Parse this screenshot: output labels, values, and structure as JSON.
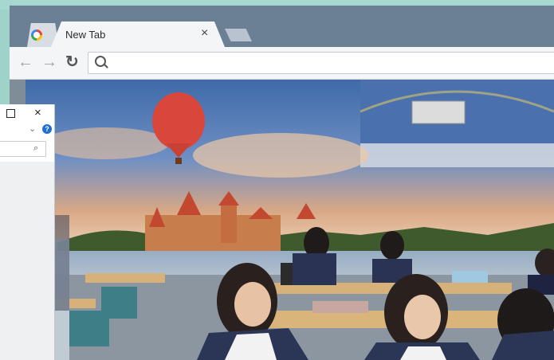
{
  "browser": {
    "tab_title": "New Tab",
    "tab_close_glyph": "×",
    "favicon": "google-icon",
    "nav": {
      "back": "←",
      "forward": "→",
      "reload": "↻"
    },
    "omnibox_value": ""
  },
  "explorer_window": {
    "maximize": "maximize-icon",
    "close_glyph": "×",
    "chevron": "⌄",
    "help": "?",
    "search_value": ""
  },
  "colors": {
    "chrome_frame": "#667a91",
    "toolbar": "#f3f5f7",
    "desktop": "#9fd3c9"
  }
}
